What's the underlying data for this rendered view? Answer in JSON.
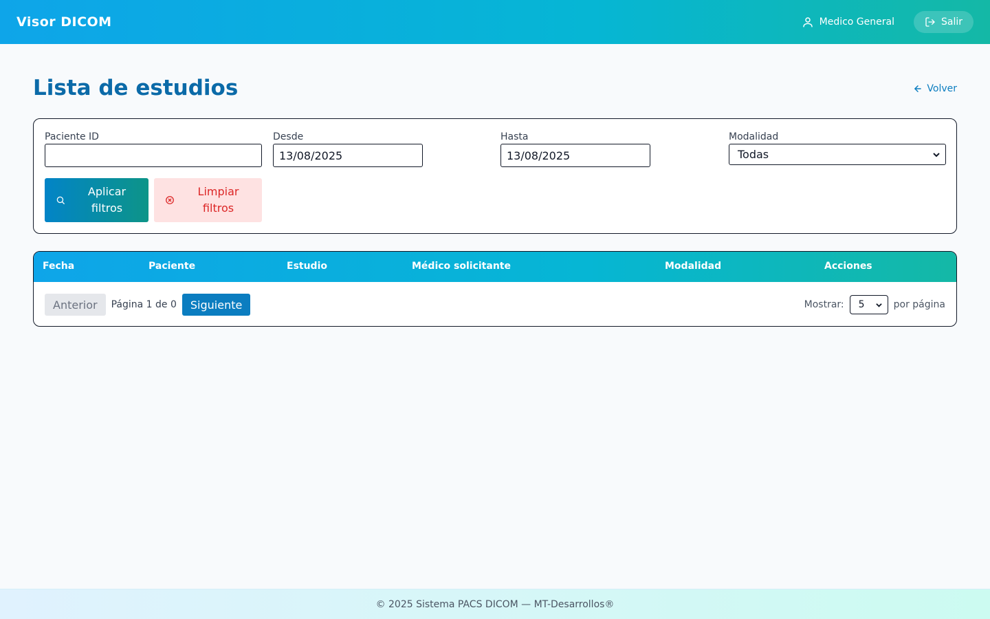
{
  "header": {
    "brand": "Visor DICOM",
    "user_name": "Medico General",
    "logout_label": "Salir"
  },
  "page": {
    "title": "Lista de estudios",
    "back_label": "Volver"
  },
  "filters": {
    "patient_id": {
      "label": "Paciente ID",
      "value": ""
    },
    "from": {
      "label": "Desde",
      "value": "13/08/2025"
    },
    "to": {
      "label": "Hasta",
      "value": "13/08/2025"
    },
    "modality": {
      "label": "Modalidad",
      "selected": "Todas"
    },
    "apply_label": "Aplicar filtros",
    "clear_label": "Limpiar filtros"
  },
  "table": {
    "columns": [
      "Fecha",
      "Paciente",
      "Estudio",
      "Médico solicitante",
      "Modalidad",
      "Acciones"
    ],
    "rows": []
  },
  "pagination": {
    "prev_label": "Anterior",
    "page_info": "Página 1 de 0",
    "next_label": "Siguiente",
    "show_label": "Mostrar:",
    "per_page_value": "5",
    "per_page_suffix": "por página"
  },
  "footer": {
    "text": "© 2025 Sistema PACS DICOM — MT-Desarrollos®"
  },
  "colors": {
    "primary": "#0b7dc0",
    "title": "#0b6aa8",
    "danger": "#dc2626",
    "danger_bg": "#fee2e2"
  }
}
